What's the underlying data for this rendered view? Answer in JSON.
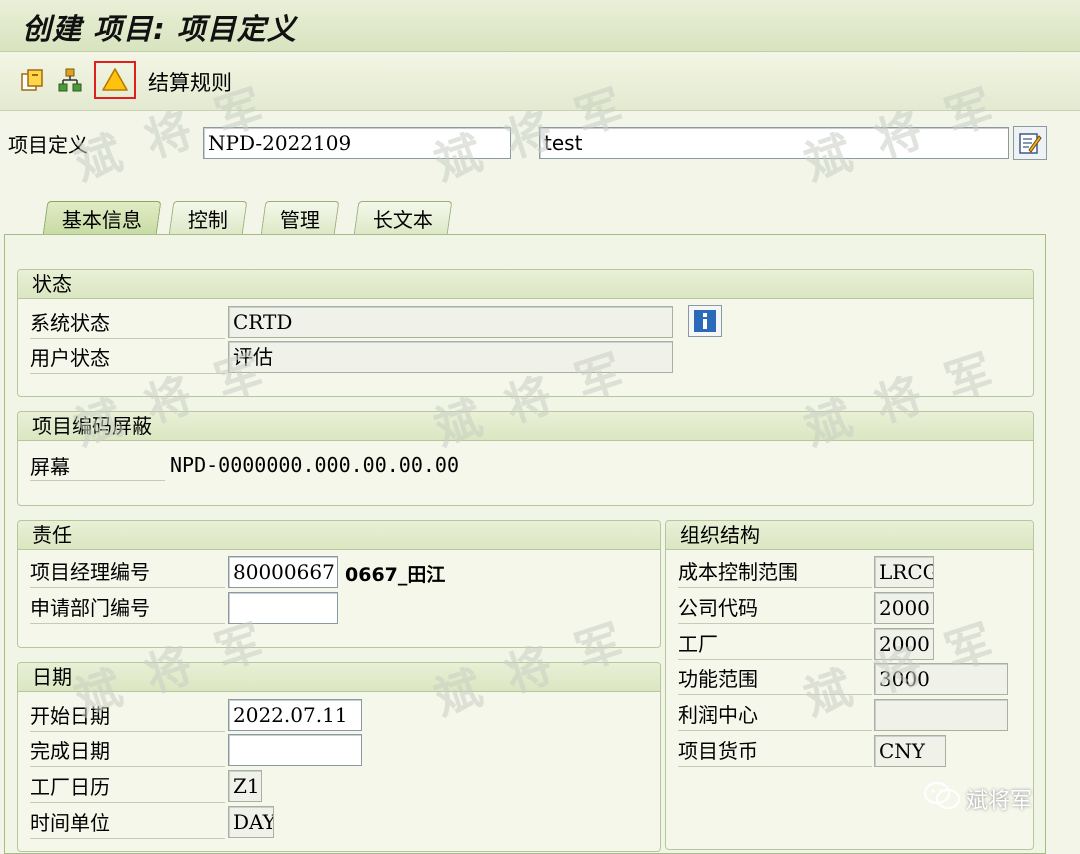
{
  "window": {
    "title": "创建 项目: 项目定义"
  },
  "toolbar": {
    "rule_label": "结算规则",
    "icons": [
      "create-icon",
      "hierarchy-icon",
      "warning-icon"
    ]
  },
  "header": {
    "label": "项目定义",
    "project_id": "NPD-2022109",
    "description": "test"
  },
  "tabs": [
    {
      "label": "基本信息",
      "active": true
    },
    {
      "label": "控制"
    },
    {
      "label": "管理"
    },
    {
      "label": "长文本"
    }
  ],
  "status": {
    "title": "状态",
    "system_label": "系统状态",
    "system_value": "CRTD",
    "user_label": "用户状态",
    "user_value": "评估"
  },
  "mask": {
    "title": "项目编码屏蔽",
    "screen_label": "屏幕",
    "screen_value": "NPD-0000000.000.00.00.00"
  },
  "responsibility": {
    "title": "责任",
    "manager_label": "项目经理编号",
    "manager_value": "80000667",
    "manager_name": "0667_田江",
    "dept_label": "申请部门编号",
    "dept_value": ""
  },
  "dates": {
    "title": "日期",
    "start_label": "开始日期",
    "start_value": "2022.07.11",
    "finish_label": "完成日期",
    "finish_value": "",
    "calendar_label": "工厂日历",
    "calendar_value": "Z1",
    "unit_label": "时间单位",
    "unit_value": "DAY"
  },
  "org": {
    "title": "组织结构",
    "rows": [
      {
        "label": "成本控制范围",
        "value": "LRCG"
      },
      {
        "label": "公司代码",
        "value": "2000"
      },
      {
        "label": "工厂",
        "value": "2000"
      },
      {
        "label": "功能范围",
        "value": "3000"
      },
      {
        "label": "利润中心",
        "value": ""
      },
      {
        "label": "项目货币",
        "value": "CNY"
      }
    ]
  },
  "watermark": {
    "text": "斌将军",
    "badge": "斌将军"
  }
}
